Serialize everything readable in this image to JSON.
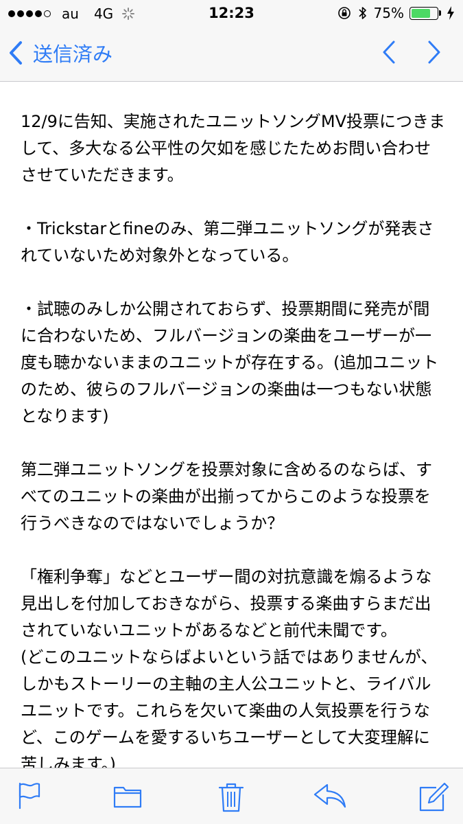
{
  "status_bar": {
    "carrier": "au",
    "network": "4G",
    "time": "12:23",
    "battery_percent": "75%",
    "battery_level": 0.75,
    "signal_bars_filled": 4,
    "signal_bars_total": 5,
    "battery_color": "#4cd964"
  },
  "nav": {
    "back_label": "送信済み",
    "accent_color": "#2f7cf6"
  },
  "message": {
    "paragraphs": [
      "12/9に告知、実施されたユニットソングMV投票につきまして、多大なる公平性の欠如を感じたためお問い合わせさせていただきます。",
      "・Trickstarとfineのみ、第二弾ユニットソングが発表されていないため対象外となっている。",
      "・試聴のみしか公開されておらず、投票期間に発売が間に合わないため、フルバージョンの楽曲をユーザーが一度も聴かないままのユニットが存在する。(追加ユニットのため、彼らのフルバージョンの楽曲は一つもない状態となります)",
      "第二弾ユニットソングを投票対象に含めるのならば、すべてのユニットの楽曲が出揃ってからこのような投票を行うべきなのではないでしょうか？",
      "「権利争奪」などとユーザー間の対抗意識を煽るような見出しを付加しておきながら、投票する楽曲すらまだ出されていないユニットがあるなどと前代未聞です。",
      "(どこのユニットならばよいという話ではありませんが、しかもストーリーの主軸の主人公ユニットと、ライバルユニットです。これらを欠いて楽曲の人気投票を行うなど、このゲームを愛するいちユーザーとして大変理解に苦しみます。)"
    ]
  },
  "toolbar": {
    "icons": [
      "flag-icon",
      "folder-icon",
      "trash-icon",
      "reply-icon",
      "compose-icon"
    ]
  }
}
